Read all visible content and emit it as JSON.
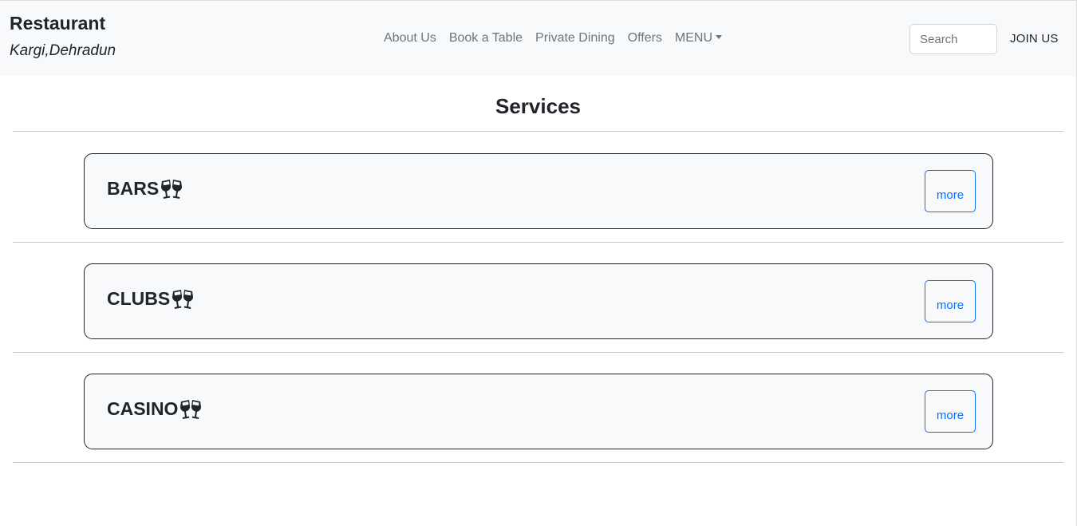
{
  "navbar": {
    "brand_title": "Restaurant",
    "brand_subtitle": "Kargi,Dehradun",
    "links": [
      {
        "label": "About Us"
      },
      {
        "label": "Book a Table"
      },
      {
        "label": "Private Dining"
      },
      {
        "label": "Offers"
      },
      {
        "label": "MENU"
      }
    ],
    "search_placeholder": "Search",
    "join_label": "JOIN US"
  },
  "main": {
    "title": "Services",
    "services": [
      {
        "title": "BARS",
        "icon": "clinking-glasses-icon",
        "button": "more"
      },
      {
        "title": "CLUBS",
        "icon": "clinking-glasses-icon",
        "button": "more"
      },
      {
        "title": "CASINO",
        "icon": "clinking-glasses-icon",
        "button": "more"
      }
    ]
  },
  "colors": {
    "navbar_bg": "#f8f9fa",
    "link_gray": "#6c757d",
    "button_blue": "#0d6efd",
    "text_dark": "#212529"
  }
}
